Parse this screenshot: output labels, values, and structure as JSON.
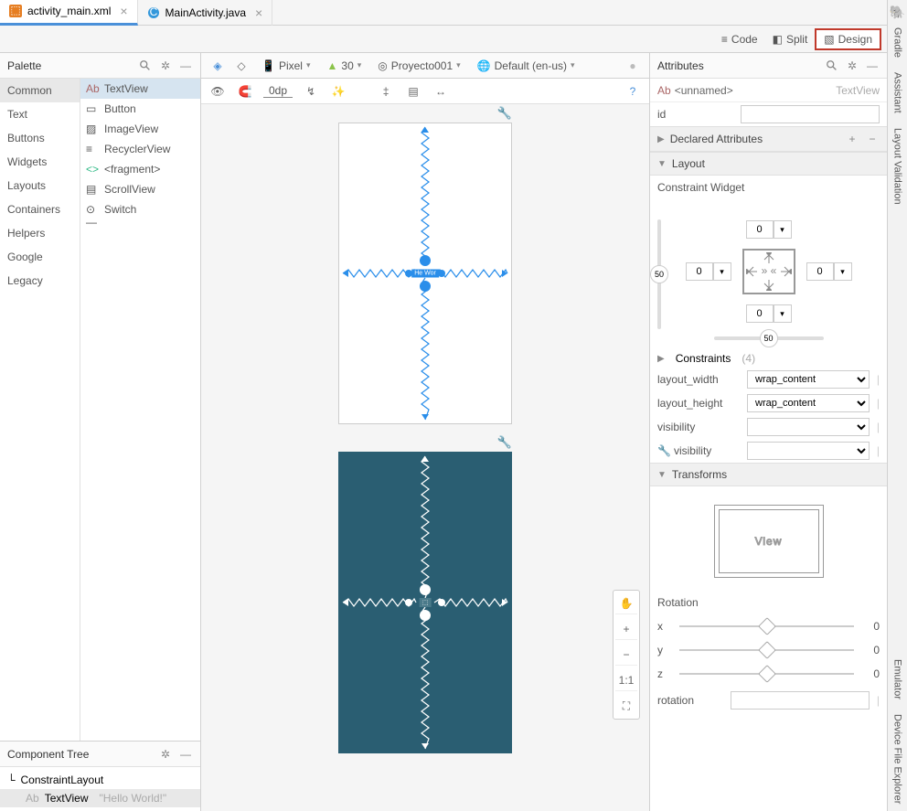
{
  "tabs": [
    {
      "label": "activity_main.xml",
      "active": true,
      "icon": "xml"
    },
    {
      "label": "MainActivity.java",
      "active": false,
      "icon": "java"
    }
  ],
  "view_modes": {
    "code": "Code",
    "split": "Split",
    "design": "Design"
  },
  "palette": {
    "title": "Palette",
    "categories": [
      "Common",
      "Text",
      "Buttons",
      "Widgets",
      "Layouts",
      "Containers",
      "Helpers",
      "Google",
      "Legacy"
    ],
    "items": [
      "TextView",
      "Button",
      "ImageView",
      "RecyclerView",
      "<fragment>",
      "ScrollView",
      "Switch"
    ]
  },
  "component_tree": {
    "title": "Component Tree",
    "root": "ConstraintLayout",
    "child": "TextView",
    "child_hint": "\"Hello World!\""
  },
  "canvas_toolbar": {
    "device": "Pixel",
    "api": "30",
    "app": "Proyecto001",
    "locale": "Default (en-us)"
  },
  "canvas_toolbar2": {
    "dp": "0dp"
  },
  "zoom": {
    "one_to_one": "1:1"
  },
  "attributes": {
    "title": "Attributes",
    "tag_prefix": "Ab",
    "tag": "<unnamed>",
    "class": "TextView",
    "id_label": "id",
    "id_value": "",
    "declared": "Declared Attributes",
    "layout": "Layout",
    "constraint_widget": "Constraint Widget",
    "cw_top": "0",
    "cw_bottom": "0",
    "cw_left": "0",
    "cw_right": "0",
    "cw_slider_left": "50",
    "cw_slider_bottom": "50",
    "constraints": "Constraints",
    "constraints_count": "(4)",
    "layout_width_label": "layout_width",
    "layout_width": "wrap_content",
    "layout_height_label": "layout_height",
    "layout_height": "wrap_content",
    "visibility_label": "visibility",
    "visibility": "",
    "tools_visibility_label": "visibility",
    "tools_visibility": "",
    "transforms": "Transforms",
    "view_preview": "View",
    "rotation_title": "Rotation",
    "rot_x_label": "x",
    "rot_x": "0",
    "rot_y_label": "y",
    "rot_y": "0",
    "rot_z_label": "z",
    "rot_z": "0",
    "rotation_label": "rotation"
  },
  "right_rail": [
    "Gradle",
    "Assistant",
    "Layout Validation",
    "Emulator",
    "Device File Explorer"
  ]
}
